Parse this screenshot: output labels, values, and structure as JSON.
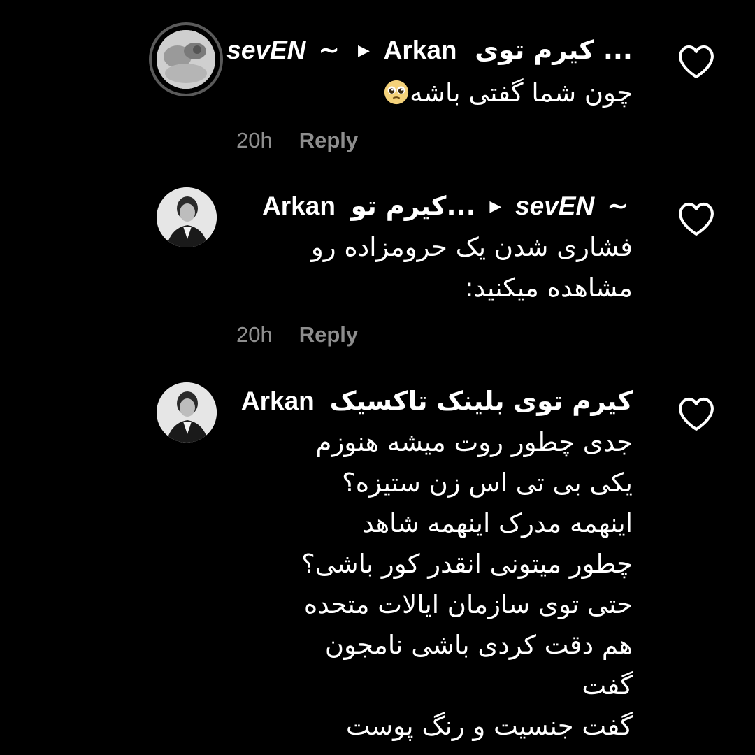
{
  "comments": [
    {
      "author": "sevEN",
      "tilde": "~",
      "recipient": "Arkan",
      "recipient_tag": "کیرم توی ...",
      "lines": [
        "چون شما گفتی باشه"
      ],
      "emoji": "pleading-face",
      "time": "20h",
      "reply_label": "Reply"
    },
    {
      "author": "Arkan",
      "author_tag": "کیرم تو...",
      "recipient": "sevEN",
      "tilde": "~",
      "lines": [
        "فشاری شدن یک حرومزاده رو",
        "مشاهده میکنید:"
      ],
      "time": "20h",
      "reply_label": "Reply"
    },
    {
      "author": "Arkan",
      "author_tag": "کیرم توی بلینک تاکسیک",
      "lines": [
        "جدی چطور روت میشه هنوزم",
        "یکی بی تی اس زن ستیزه؟",
        "اینهمه مدرک اینهمه شاهد",
        "چطور میتونی انقدر کور باشی؟",
        "حتی توی سازمان ایالات متحده",
        "هم دقت کردی باشی نامجون",
        "گفت",
        "گفت جنسیت و رنگ پوست"
      ]
    }
  ],
  "icons": {
    "heart": "heart-outline-icon",
    "arrow": "caret-right-icon"
  },
  "colors": {
    "background": "#000000",
    "text": "#ffffff",
    "meta": "#8e8e8e"
  }
}
